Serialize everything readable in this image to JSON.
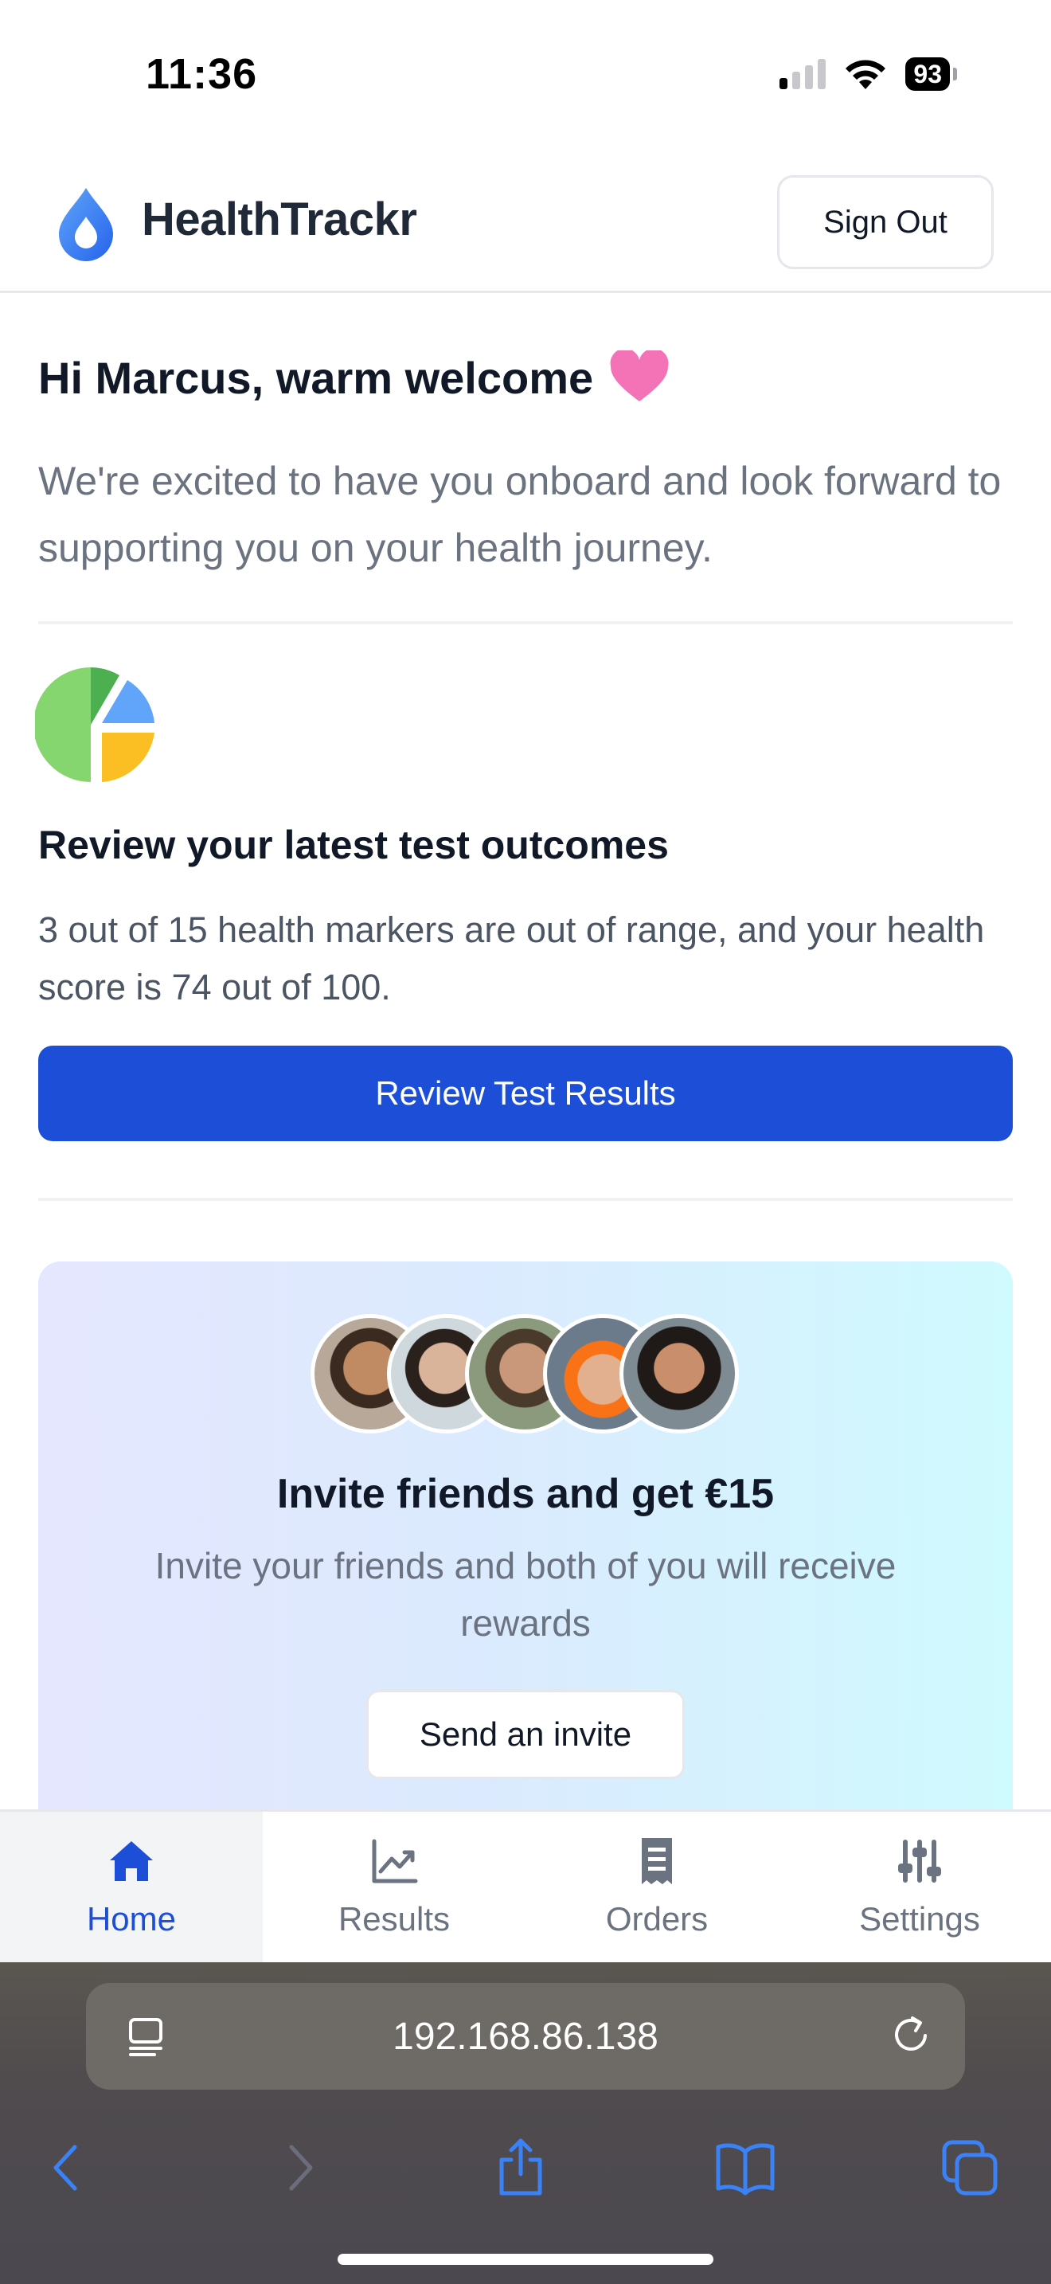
{
  "status_bar": {
    "time": "11:36",
    "battery": "93"
  },
  "header": {
    "app_name": "HealthTrackr",
    "sign_out_label": "Sign Out",
    "logo_color": "#3b82f6"
  },
  "welcome": {
    "greeting": "Hi Marcus, warm welcome",
    "heart_icon": "heart-icon",
    "intro": "We're excited to have you onboard and look forward to supporting you on your health journey."
  },
  "results_section": {
    "icon": "pie-chart-icon",
    "title": "Review your latest test outcomes",
    "body": "3 out of 15 health markers are out of range, and your health score is 74 out of 100.",
    "button_label": "Review Test Results",
    "accent": "#1d4ed8"
  },
  "invite": {
    "title": "Invite friends and get €15",
    "subtitle": "Invite your friends and both of you will receive rewards",
    "button_label": "Send an invite"
  },
  "bottom_nav": {
    "items": [
      {
        "label": "Home",
        "icon": "home-icon",
        "active": true
      },
      {
        "label": "Results",
        "icon": "chart-line-icon",
        "active": false
      },
      {
        "label": "Orders",
        "icon": "receipt-icon",
        "active": false
      },
      {
        "label": "Settings",
        "icon": "sliders-icon",
        "active": false
      }
    ]
  },
  "browser": {
    "url": "192.168.86.138"
  }
}
